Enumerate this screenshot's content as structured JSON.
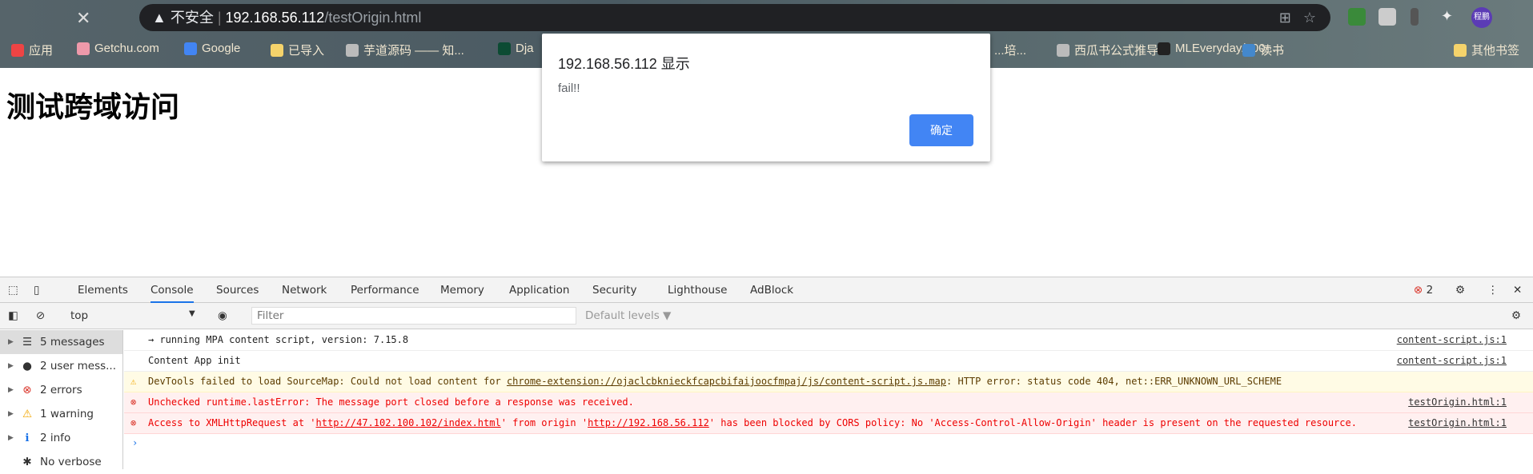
{
  "browser": {
    "security_label": "不安全",
    "url_host": "192.168.56.112",
    "url_path": "/testOrigin.html",
    "avatar": "程鹏",
    "bookmarks": [
      {
        "label": "应用",
        "color": "#e44"
      },
      {
        "label": "Getchu.com",
        "color": "#e9a"
      },
      {
        "label": "Google",
        "color": "#4285f4"
      },
      {
        "label": "已导入",
        "color": "#f5d36b"
      },
      {
        "label": "芋道源码 —— 知...",
        "color": "#bbb"
      },
      {
        "label": "Dja",
        "color": "#0c4b33"
      },
      {
        "label": "...培...",
        "color": "#0000"
      },
      {
        "label": "西瓜书公式推导",
        "color": "#bbb"
      },
      {
        "label": "MLEveryday/100-...",
        "color": "#222"
      },
      {
        "label": "读书",
        "color": "#48c"
      },
      {
        "label": "其他书签",
        "color": "#f5d36b"
      }
    ]
  },
  "page": {
    "heading": "测试跨域访问"
  },
  "dialog": {
    "title": "192.168.56.112 显示",
    "message": "fail!!",
    "ok": "确定"
  },
  "devtools": {
    "tabs": [
      "Elements",
      "Console",
      "Sources",
      "Network",
      "Performance",
      "Memory",
      "Application",
      "Security",
      "Lighthouse",
      "AdBlock"
    ],
    "active_tab": "Console",
    "error_count": "2",
    "context": "top",
    "filter_placeholder": "Filter",
    "levels": "Default levels ▼",
    "sidebar": [
      "5 messages",
      "2 user mess...",
      "2 errors",
      "1 warning",
      "2 info",
      "No verbose"
    ],
    "messages": [
      {
        "level": "log",
        "text": "→ running MPA content script, version: 7.15.8",
        "source": "content-script.js:1"
      },
      {
        "level": "log",
        "text": "Content App init",
        "source": "content-script.js:1"
      },
      {
        "level": "warning",
        "prefix": "DevTools failed to load SourceMap: Could not load content for ",
        "link": "chrome-extension://ojaclcbknieckfcapcbifaijoocfmpaj/js/content-script.js.map",
        "suffix": ": HTTP error: status code 404, net::ERR_UNKNOWN_URL_SCHEME"
      },
      {
        "level": "error",
        "text": "Unchecked runtime.lastError: The message port closed before a response was received.",
        "source": "testOrigin.html:1"
      },
      {
        "level": "error",
        "p1": "Access to XMLHttpRequest at '",
        "l1": "http://47.102.100.102/index.html",
        "p2": "' from origin '",
        "l2": "http://192.168.56.112",
        "p3": "' has been blocked by CORS policy: No 'Access-Control-Allow-Origin' header is present on the requested resource.",
        "source": "testOrigin.html:1"
      }
    ]
  }
}
